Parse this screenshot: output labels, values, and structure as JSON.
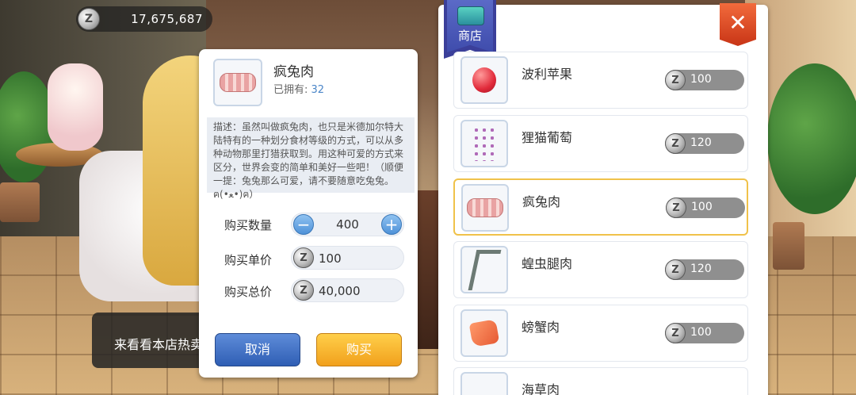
{
  "currency": {
    "icon": "zeny-coin-icon",
    "coin_symbol": "Z",
    "amount": "17,675,687"
  },
  "hot_items": {
    "text": "来看看本店热卖"
  },
  "purchase": {
    "item_name": "疯兔肉",
    "owned_label": "已拥有:",
    "owned_count": "32",
    "description": "描述：虽然叫做疯兔肉，也只是米德加尔特大陆特有的一种划分食材等级的方式，可以从多种动物那里打猎获取到。用这种可爱的方式来区分，世界会变的简单和美好一些吧！（顺便一提：兔兔那么可爱，请不要随意吃兔兔。ฅ(•ﻌ•)ฅ）",
    "quantity_label": "购买数量",
    "quantity": "400",
    "minus_symbol": "−",
    "plus_symbol": "+",
    "unit_price_label": "购买单价",
    "unit_price": "100",
    "total_label": "购买总价",
    "total_price": "40,000",
    "cancel_label": "取消",
    "buy_label": "购买"
  },
  "shop": {
    "title": "商店",
    "close_symbol": "✕",
    "items": [
      {
        "name": "波利苹果",
        "price": "100",
        "icon": "apple-icon",
        "selected": false
      },
      {
        "name": "狸猫葡萄",
        "price": "120",
        "icon": "grape-icon",
        "selected": false
      },
      {
        "name": "疯兔肉",
        "price": "100",
        "icon": "meat-icon",
        "selected": true
      },
      {
        "name": "蝗虫腿肉",
        "price": "120",
        "icon": "insect-leg-icon",
        "selected": false
      },
      {
        "name": "螃蟹肉",
        "price": "100",
        "icon": "crab-meat-icon",
        "selected": false
      },
      {
        "name": "海草肉",
        "price": "",
        "icon": "seaweed-meat-icon",
        "selected": false
      }
    ]
  },
  "colors": {
    "accent_blue": "#4b86c8",
    "buy_orange": "#f1a01c",
    "cancel_blue": "#2f5eb4",
    "selected_border": "#f0c24a",
    "close_red": "#c83516"
  }
}
